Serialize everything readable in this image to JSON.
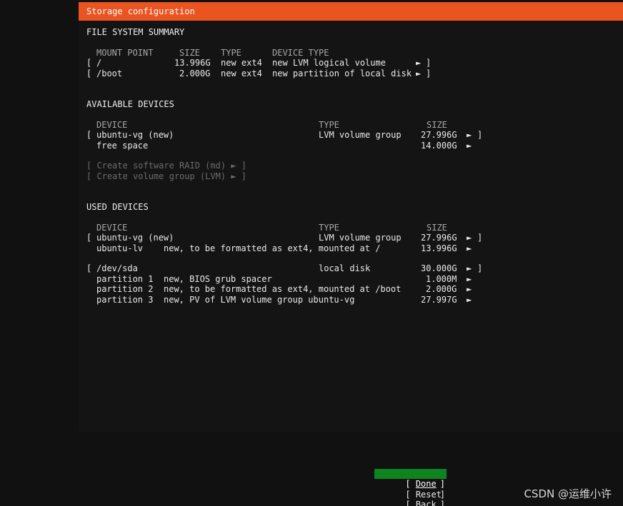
{
  "title": "Storage configuration",
  "fs_summary": {
    "heading": "FILE SYSTEM SUMMARY",
    "headers": {
      "mount_point": "MOUNT POINT",
      "size": "SIZE",
      "type": "TYPE",
      "device_type": "DEVICE TYPE"
    },
    "rows": [
      {
        "lb": "[",
        "mount": "/",
        "size": "13.996G",
        "type": "new ext4",
        "device_type": "new LVM logical volume",
        "arrow": "►",
        "rb": "]"
      },
      {
        "lb": "[",
        "mount": "/boot",
        "size": "2.000G",
        "type": "new ext4",
        "device_type": "new partition of local disk",
        "arrow": "►",
        "rb": "]"
      }
    ]
  },
  "available": {
    "heading": "AVAILABLE DEVICES",
    "headers": {
      "device": "DEVICE",
      "type": "TYPE",
      "size": "SIZE"
    },
    "rows": [
      {
        "lb": "[",
        "device": "ubuntu-vg (new)",
        "type": "LVM volume group",
        "size": "27.996G",
        "arrow": "►",
        "rb": "]"
      },
      {
        "lb": "",
        "device": "free space",
        "type": "",
        "size": "14.000G",
        "arrow": "►",
        "rb": ""
      }
    ],
    "actions": [
      {
        "label": "[ Create software RAID (md) ► ]"
      },
      {
        "label": "[ Create volume group (LVM) ► ]"
      }
    ]
  },
  "used": {
    "heading": "USED DEVICES",
    "headers": {
      "device": "DEVICE",
      "type": "TYPE",
      "size": "SIZE"
    },
    "groups": [
      {
        "lb": "[",
        "device": "ubuntu-vg (new)",
        "type": "LVM volume group",
        "size": "27.996G",
        "arrow": "►",
        "rb": "]",
        "children": [
          {
            "name": "ubuntu-lv",
            "desc": "new, to be formatted as ext4, mounted at /",
            "size": "13.996G",
            "arrow": "►"
          }
        ]
      },
      {
        "lb": "[",
        "device": "/dev/sda",
        "type": "local disk",
        "size": "30.000G",
        "arrow": "►",
        "rb": "]",
        "children": [
          {
            "name": "partition 1",
            "desc": "new, BIOS grub spacer",
            "size": "1.000M",
            "arrow": "►"
          },
          {
            "name": "partition 2",
            "desc": "new, to be formatted as ext4, mounted at /boot",
            "size": "2.000G",
            "arrow": "►"
          },
          {
            "name": "partition 3",
            "desc": "new, PV of LVM volume group ubuntu-vg",
            "size": "27.997G",
            "arrow": "►"
          }
        ]
      }
    ]
  },
  "buttons": [
    {
      "open": "[ ",
      "label": "Done",
      "close": "]",
      "selected": true
    },
    {
      "open": "[ ",
      "label": "Reset",
      "close": "]",
      "selected": false
    },
    {
      "open": "[ ",
      "label": "Back",
      "close": "]",
      "selected": false
    }
  ],
  "watermark": "CSDN @运维小许",
  "colors": {
    "title_bar": "#e95420",
    "selected_button": "#0e8420",
    "background": "#111111"
  }
}
